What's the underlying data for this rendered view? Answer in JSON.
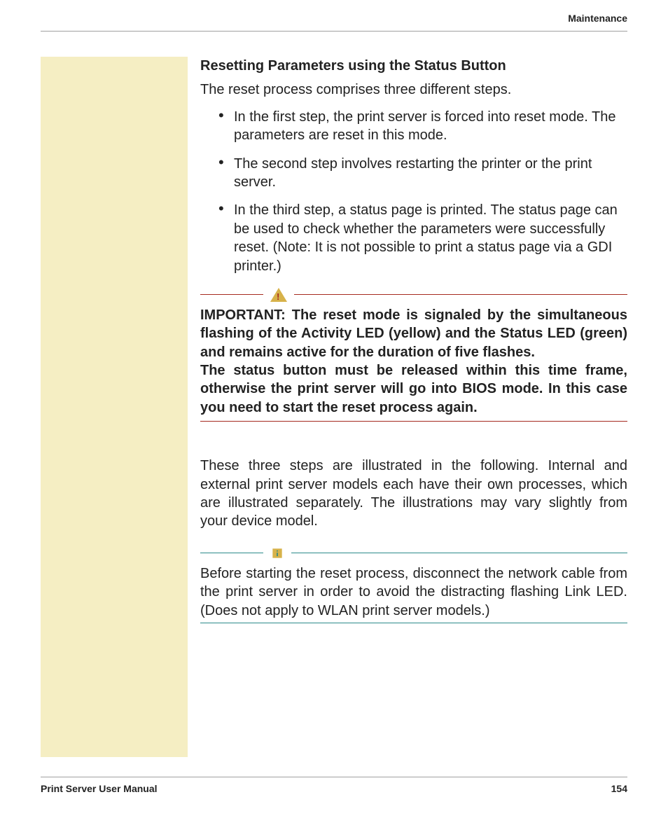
{
  "header": {
    "section": "Maintenance"
  },
  "content": {
    "title": "Resetting Parameters using the Status Button",
    "intro": "The reset process comprises three different steps.",
    "steps": [
      "In the first step, the print server is forced into reset mode. The parameters are reset in this mode.",
      "The second step involves restarting the printer or the print server.",
      "In the third step, a status page is printed. The status page can be used to check whether the parameters were successfully reset. (Note: It is not possible to print a status page via a GDI printer.)"
    ],
    "important": {
      "p1": "IMPORTANT: The reset mode is signaled by the simultaneous flashing of the Activity LED (yellow) and the Status LED (green) and remains active for the duration of five flashes.",
      "p2": "The status button must be released within this time frame, otherwise the print server will go into BIOS mode. In this case you need to start the reset process again."
    },
    "body": "These three steps are illustrated in the following. Internal and external print server models each have their own processes, which are illustrated separately. The illustrations may vary slightly from your device model.",
    "info": "Before starting the reset process, disconnect the network cable from the print server in order to avoid the distracting flashing Link LED. (Does not apply to WLAN print server models.)"
  },
  "footer": {
    "manual": "Print Server User Manual",
    "page": "154"
  }
}
